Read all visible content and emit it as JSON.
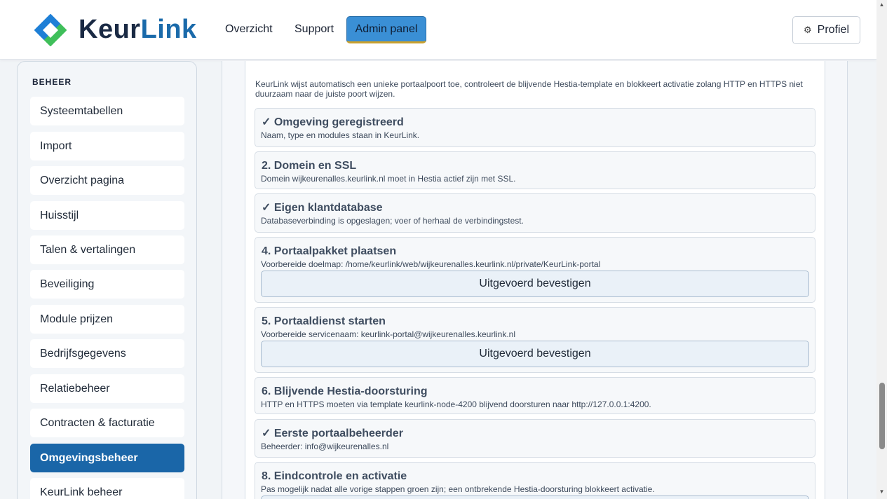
{
  "header": {
    "brand_part1": "Keur",
    "brand_part2": "Link",
    "nav": [
      "Overzicht",
      "Support",
      "Admin panel"
    ],
    "profile_label": "Profiel",
    "profile_icon": "gear-icon"
  },
  "sidebar": {
    "heading": "BEHEER",
    "items": [
      "Systeemtabellen",
      "Import",
      "Overzicht pagina",
      "Huisstijl",
      "Talen & vertalingen",
      "Beveiliging",
      "Module prijzen",
      "Bedrijfsgegevens",
      "Relatiebeheer",
      "Contracten & facturatie",
      "Omgevingsbeheer",
      "KeurLink beheer"
    ],
    "active_item": "Omgevingsbeheer"
  },
  "main": {
    "intro": "KeurLink wijst automatisch een unieke portaalpoort toe, controleert de blijvende Hestia-template en blokkeert activatie zolang HTTP en HTTPS niet duurzaam naar de juiste poort wijzen.",
    "steps": [
      {
        "title": "✓ Omgeving geregistreerd",
        "desc": "Naam, type en modules staan in KeurLink.",
        "done": true
      },
      {
        "title": "2. Domein en SSL",
        "desc": "Domein wijkeurenalles.keurlink.nl moet in Hestia actief zijn met SSL.",
        "done": false
      },
      {
        "title": "✓ Eigen klantdatabase",
        "desc": "Databaseverbinding is opgeslagen; voer of herhaal de verbindingstest.",
        "done": true
      },
      {
        "title": "4. Portaalpakket plaatsen",
        "desc": "Voorbereide doelmap: /home/keurlink/web/wijkeurenalles.keurlink.nl/private/KeurLink-portal",
        "button": "Uitgevoerd bevestigen",
        "done": false
      },
      {
        "title": "5. Portaaldienst starten",
        "desc": "Voorbereide servicenaam: keurlink-portal@wijkeurenalles.keurlink.nl",
        "button": "Uitgevoerd bevestigen",
        "done": false
      },
      {
        "title": "6. Blijvende Hestia-doorsturing",
        "desc": "HTTP en HTTPS moeten via template keurlink-node-4200 blijvend doorsturen naar http://127.0.0.1:4200.",
        "done": false
      },
      {
        "title": "✓ Eerste portaalbeheerder",
        "desc": "Beheerder: info@wijkeurenalles.nl",
        "done": true
      },
      {
        "title": "8. Eindcontrole en activatie",
        "desc": "Pas mogelijk nadat alle vorige stappen groen zijn; een ontbrekende Hestia-doorsturing blokkeert activatie.",
        "done": false
      }
    ]
  },
  "colors": {
    "brand_dark": "#1a2a44",
    "brand_blue": "#1a6aaa",
    "active_nav": "#1a66a8",
    "admin_button": "#3a8fd5"
  }
}
